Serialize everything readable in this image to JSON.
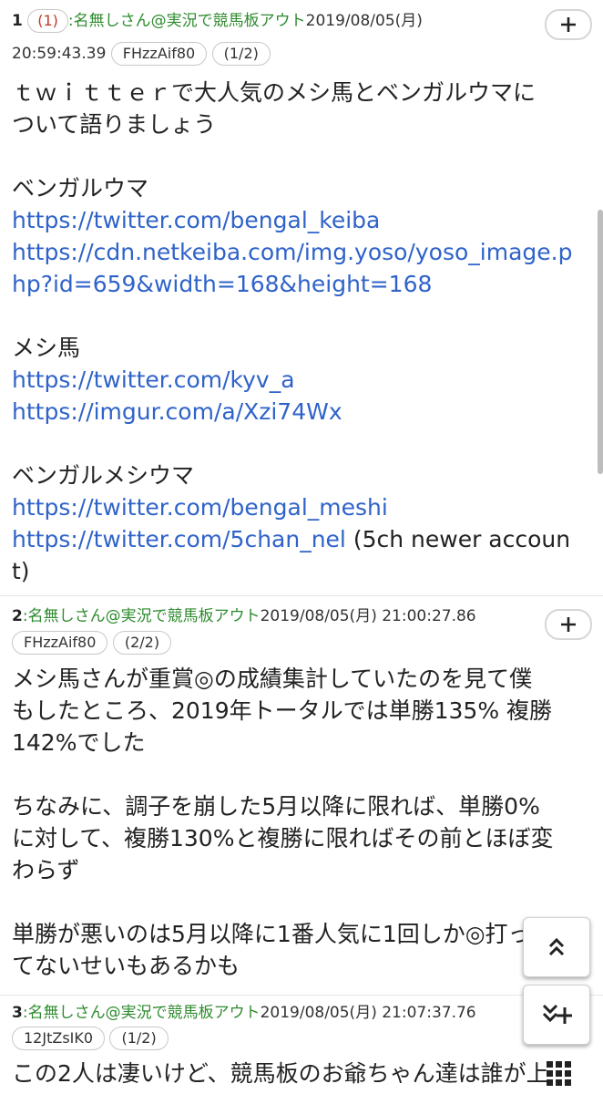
{
  "posts": [
    {
      "number": "1",
      "reply_count": "(1)",
      "name": ":名無しさん@実況で競馬板アウト",
      "date": "2019/08/05(月)",
      "time": "20:59:43.39",
      "id": "FHzzAif80",
      "count": "(1/2)",
      "lines": [
        {
          "text": "ｔｗｉｔｔｅｒで大人気のメシ馬とベンガルウマに",
          "link": false
        },
        {
          "text": "ついて語りましょう",
          "link": false
        },
        {
          "text": "",
          "link": false
        },
        {
          "text": "ベンガルウマ",
          "link": false
        },
        {
          "text": "https://twitter.com/bengal_keiba",
          "link": true
        },
        {
          "text": "https://cdn.netkeiba.com/img.yoso/yoso_image.p",
          "link": true
        },
        {
          "text": "hp?id=659&width=168&height=168",
          "link": true
        },
        {
          "text": "",
          "link": false
        },
        {
          "text": "メシ馬",
          "link": false
        },
        {
          "text": "https://twitter.com/kyv_a",
          "link": true
        },
        {
          "text": "https://imgur.com/a/Xzi74Wx",
          "link": true
        },
        {
          "text": "",
          "link": false
        },
        {
          "text": "ベンガルメシウマ",
          "link": false
        },
        {
          "text": "https://twitter.com/bengal_meshi",
          "link": true
        },
        {
          "text": "https://twitter.com/5chan_nel",
          "link": true,
          "suffix": " (5ch newer accoun"
        },
        {
          "text": "t)",
          "link": false
        }
      ]
    },
    {
      "number": "2",
      "name": ":名無しさん@実況で競馬板アウト",
      "date": "2019/08/05(月) 21:00:27.86",
      "id": "FHzzAif80",
      "count": "(2/2)",
      "lines": [
        {
          "text": "メシ馬さんが重賞◎の成績集計していたのを見て僕",
          "link": false
        },
        {
          "text": "もしたところ、2019年トータルでは単勝135% 複勝",
          "link": false
        },
        {
          "text": "142%でした",
          "link": false
        },
        {
          "text": "",
          "link": false
        },
        {
          "text": "ちなみに、調子を崩した5月以降に限れば、単勝0%",
          "link": false
        },
        {
          "text": "に対して、複勝130%と複勝に限ればその前とほぼ変",
          "link": false
        },
        {
          "text": "わらず",
          "link": false
        },
        {
          "text": "",
          "link": false
        },
        {
          "text": "単勝が悪いのは5月以降に1番人気に1回しか◎打っ",
          "link": false
        },
        {
          "text": "てないせいもあるかも",
          "link": false
        }
      ]
    },
    {
      "number": "3",
      "name": ":名無しさん@実況で競馬板アウト",
      "date": "2019/08/05(月) 21:07:37.76",
      "id": "12JtZsIK0",
      "count": "(1/2)",
      "lines": [
        {
          "text": "この2人は凄いけど、競馬板のお爺ちゃん達は誰が上",
          "link": false
        }
      ]
    }
  ],
  "icons": {
    "plus": "plus-icon",
    "scroll_top": "double-chevron-up-icon",
    "scroll_bottom": "double-chevron-down-plus-icon",
    "grid": "grid-icon"
  },
  "colors": {
    "name": "#2e8b2e",
    "link": "#2f63c9",
    "reply": "#c0392b"
  }
}
